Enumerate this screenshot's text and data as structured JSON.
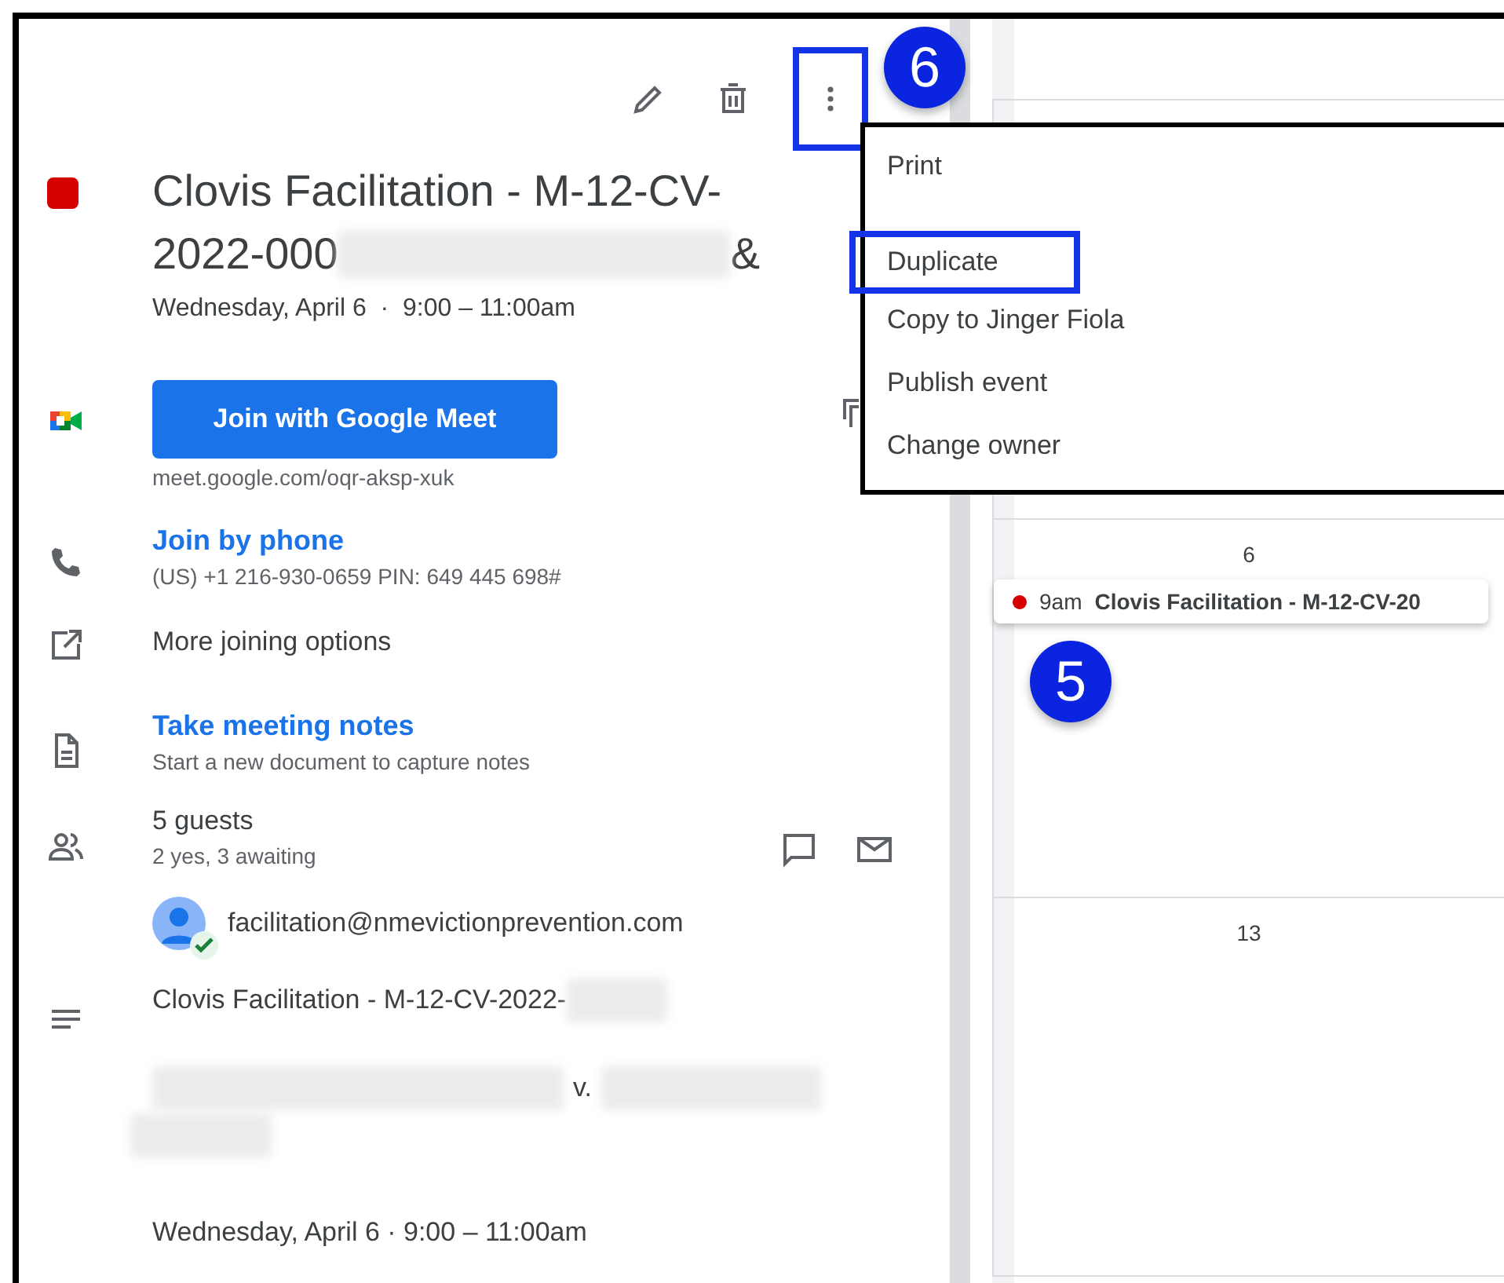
{
  "toolbar": {
    "more_highlighted": true
  },
  "event": {
    "color": "#d50000",
    "title_line_1": "Clovis Facilitation - M-12-CV-",
    "title_line_2_start": "2022-000",
    "title_line_2_end": "&",
    "date_time": "Wednesday, April 6  ·  9:00 – 11:00am"
  },
  "meet": {
    "button": "Join with Google Meet",
    "link": "meet.google.com/oqr-aksp-xuk"
  },
  "phone": {
    "title": "Join by phone",
    "detail": "(US) +1 216-930-0659 PIN: 649 445 698#"
  },
  "more_options": "More joining options",
  "notes": {
    "title": "Take meeting notes",
    "detail": "Start a new document to capture notes"
  },
  "guests": {
    "title": "5 guests",
    "summary": "2 yes, 3 awaiting",
    "list": [
      {
        "email": "facilitation@nmevictionprevention.com",
        "accepted": true
      }
    ]
  },
  "description": {
    "line_1": "Clovis Facilitation - M-12-CV-2022-",
    "line_2": "v.",
    "date_time": "Wednesday, April 6 · 9:00 – 11:00am"
  },
  "menu": {
    "items": [
      {
        "label": "Print",
        "highlighted": false
      },
      {
        "label": "Duplicate",
        "highlighted": true
      },
      {
        "label": "Copy to Jinger Fiola",
        "highlighted": false
      },
      {
        "label": "Publish event",
        "highlighted": false
      },
      {
        "label": "Change owner",
        "highlighted": false
      }
    ]
  },
  "calendar": {
    "days": [
      {
        "date": "6",
        "events": [
          {
            "time": "9am",
            "title": "Clovis Facilitation - M-12-CV-20",
            "color": "#d50000"
          }
        ]
      },
      {
        "date": "13"
      }
    ]
  },
  "callouts": [
    "6",
    "5"
  ]
}
